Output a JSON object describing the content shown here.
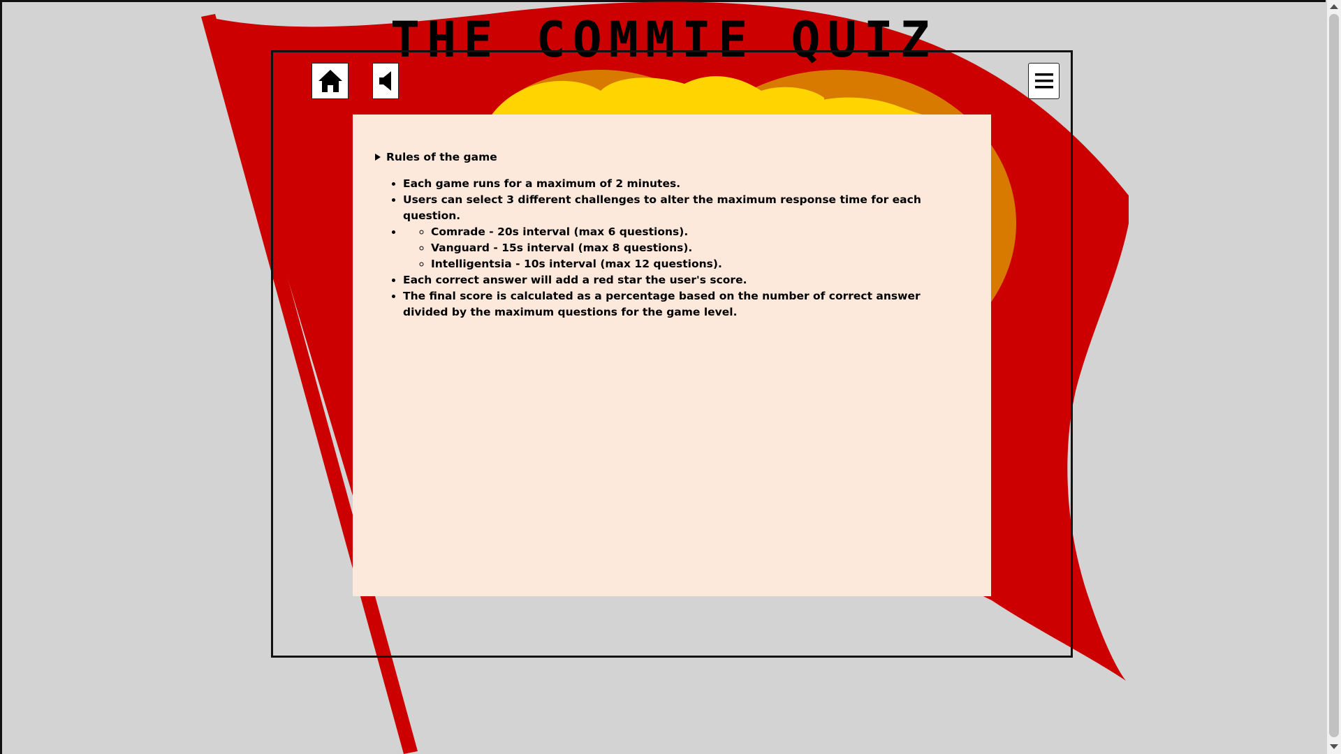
{
  "header": {
    "title": "THE COMMIE QUIZ"
  },
  "toolbar": {
    "home_icon": "home-icon",
    "sound_icon": "speaker-icon",
    "menu_icon": "hamburger-menu-icon"
  },
  "rules": {
    "summary_label": "Rules of the game",
    "items": [
      "Each game runs for a maximum of 2 minutes.",
      "Users can select 3 different challenges to alter the maximum response time for each question."
    ],
    "challenges": [
      "Comrade - 20s interval (max 6 questions).",
      "Vanguard - 15s interval (max 8 questions).",
      "Intelligentsia - 10s interval (max 12 questions)."
    ],
    "closing_items": [
      "Each correct answer will add a red star the user's score.",
      "The final score is calculated as a percentage based on the number of correct answer divided by the maximum questions for the game level."
    ]
  },
  "colors": {
    "background": "#d3d3d3",
    "flag_red": "#cc0000",
    "emblem_orange": "#d97a00",
    "emblem_yellow": "#ffd400",
    "panel_bg": "#fde8dc"
  }
}
